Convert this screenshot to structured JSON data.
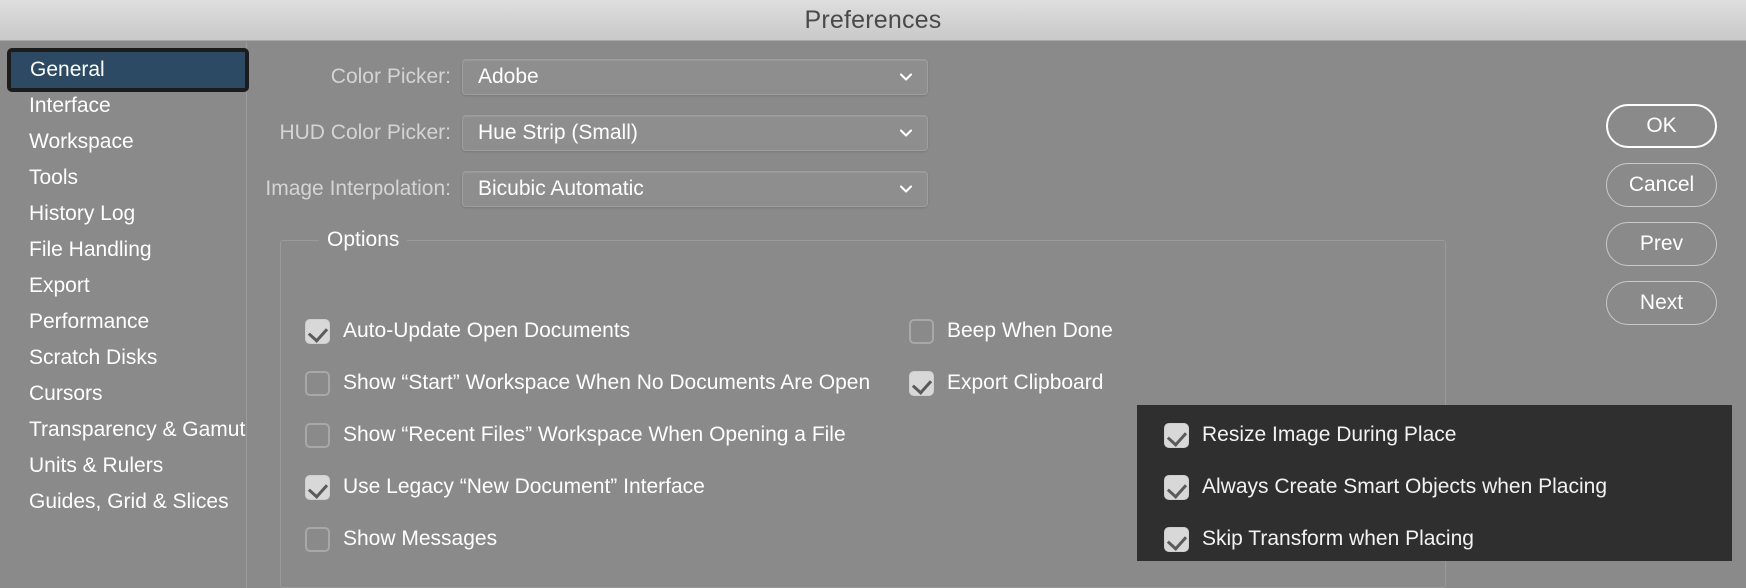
{
  "window": {
    "title": "Preferences"
  },
  "sidebar": {
    "items": [
      {
        "label": "General",
        "selected": true
      },
      {
        "label": "Interface",
        "selected": false
      },
      {
        "label": "Workspace",
        "selected": false
      },
      {
        "label": "Tools",
        "selected": false
      },
      {
        "label": "History Log",
        "selected": false
      },
      {
        "label": "File Handling",
        "selected": false
      },
      {
        "label": "Export",
        "selected": false
      },
      {
        "label": "Performance",
        "selected": false
      },
      {
        "label": "Scratch Disks",
        "selected": false
      },
      {
        "label": "Cursors",
        "selected": false
      },
      {
        "label": "Transparency & Gamut",
        "selected": false
      },
      {
        "label": "Units & Rulers",
        "selected": false
      },
      {
        "label": "Guides, Grid & Slices",
        "selected": false
      }
    ]
  },
  "fields": [
    {
      "label": "Color Picker:",
      "value": "Adobe",
      "icon": "chevron-down-icon"
    },
    {
      "label": "HUD Color Picker:",
      "value": "Hue Strip (Small)",
      "icon": "chevron-down-icon"
    },
    {
      "label": "Image Interpolation:",
      "value": "Bicubic Automatic",
      "icon": "chevron-down-icon"
    }
  ],
  "options": {
    "legend": "Options",
    "left_column": [
      {
        "label": "Auto-Update Open Documents",
        "checked": true
      },
      {
        "label": "Show “Start” Workspace When No Documents Are Open",
        "checked": false
      },
      {
        "label": "Show “Recent Files” Workspace When Opening a File",
        "checked": false
      },
      {
        "label": "Use Legacy “New Document” Interface",
        "checked": true
      },
      {
        "label": "Show Messages",
        "checked": false
      }
    ],
    "right_column": [
      {
        "label": "Beep When Done",
        "checked": false
      },
      {
        "label": "Export Clipboard",
        "checked": true
      }
    ]
  },
  "dark_panel": {
    "items": [
      {
        "label": "Resize Image During Place",
        "checked": true
      },
      {
        "label": "Always Create Smart Objects when Placing",
        "checked": true
      },
      {
        "label": "Skip Transform when Placing",
        "checked": true
      }
    ]
  },
  "buttons": [
    {
      "label": "OK",
      "primary": true
    },
    {
      "label": "Cancel",
      "primary": false
    },
    {
      "label": "Prev",
      "primary": false
    },
    {
      "label": "Next",
      "primary": false
    }
  ],
  "colors": {
    "dialog_bg": "#8a8a8a",
    "titlebar_bg": "#d6d6d6",
    "selection_blue": "#2c4a63",
    "panel_dark": "#2f2f2f",
    "text_white": "#ffffff"
  }
}
